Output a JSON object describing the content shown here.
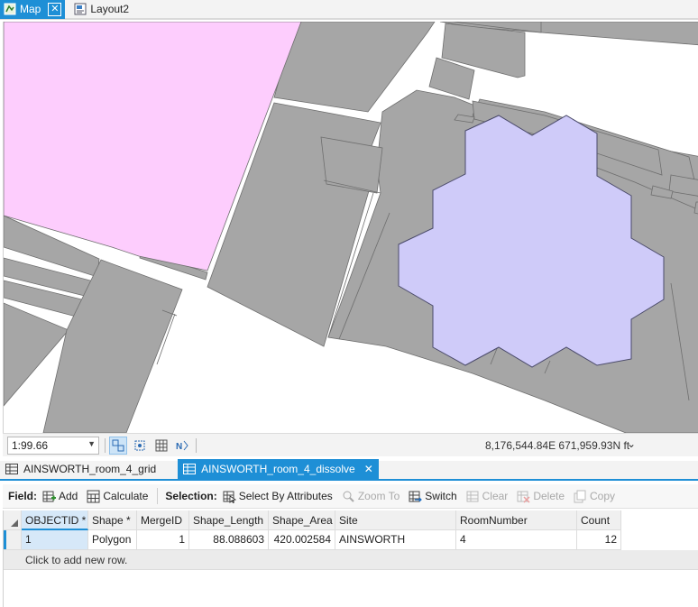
{
  "doc_tabs": [
    {
      "label": "Map",
      "active": true
    },
    {
      "label": "Layout2",
      "active": false
    }
  ],
  "map": {
    "colors": {
      "building": "#a6a6a6",
      "building_stroke": "#6e6e6e",
      "pink_feature": "#fdcdfd",
      "dissolve_feature": "#cfcbf9",
      "dissolve_stroke": "#4a4a6a",
      "background": "#ffffff"
    }
  },
  "status": {
    "scale": "1:99.66",
    "coordinates": "8,176,544.84E 671,959.93N ft"
  },
  "table_tabs": [
    {
      "label": "AINSWORTH_room_4_grid",
      "active": false
    },
    {
      "label": "AINSWORTH_room_4_dissolve",
      "active": true
    }
  ],
  "toolbar": {
    "field_label": "Field:",
    "add_label": "Add",
    "calculate_label": "Calculate",
    "selection_label": "Selection:",
    "select_by_attributes_label": "Select By Attributes",
    "zoom_to_label": "Zoom To",
    "switch_label": "Switch",
    "clear_label": "Clear",
    "delete_label": "Delete",
    "copy_label": "Copy"
  },
  "table": {
    "columns": [
      "OBJECTID *",
      "Shape *",
      "MergeID",
      "Shape_Length",
      "Shape_Area",
      "Site",
      "RoomNumber",
      "Count"
    ],
    "rows": [
      [
        "1",
        "Polygon",
        "1",
        "88.088603",
        "420.002584",
        "AINSWORTH",
        "4",
        "12"
      ]
    ],
    "add_row_text": "Click to add new row."
  }
}
